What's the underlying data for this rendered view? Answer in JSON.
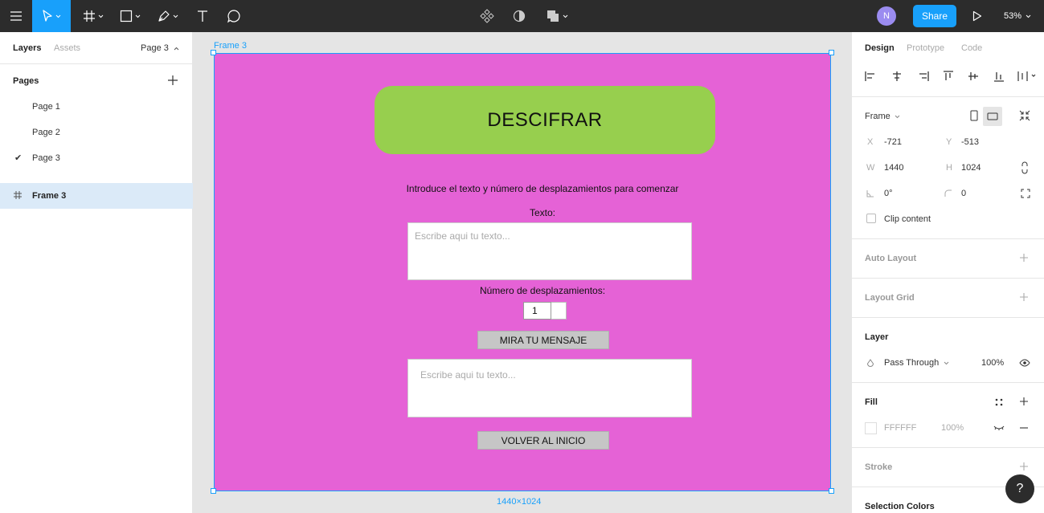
{
  "toolbar": {
    "share_label": "Share",
    "zoom": "53%",
    "avatar_initial": "N"
  },
  "left_panel": {
    "tabs": [
      "Layers",
      "Assets"
    ],
    "current_page": "Page 3",
    "pages_heading": "Pages",
    "pages": [
      "Page 1",
      "Page 2",
      "Page 3"
    ],
    "selected_page_check": "✔",
    "layer_name": "Frame 3"
  },
  "canvas": {
    "frame_label": "Frame 3",
    "size_label": "1440×1024",
    "frame_fill": "#e562d6",
    "title_button": "DESCIFRAR",
    "intro_text": "Introduce el texto y número de desplazamientos para comenzar",
    "texto_label": "Texto:",
    "texto_placeholder": "Escribe aqui tu texto...",
    "num_label": "Número de desplazamientos:",
    "num_value": "1",
    "message_button": "MIRA TU MENSAJE",
    "output_placeholder": "Escribe aqui tu texto...",
    "back_button": "VOLVER AL INICIO"
  },
  "right_panel": {
    "tabs": [
      "Design",
      "Prototype",
      "Code"
    ],
    "frame_type": "Frame",
    "x_label": "X",
    "x_value": "-721",
    "y_label": "Y",
    "y_value": "-513",
    "w_label": "W",
    "w_value": "1440",
    "h_label": "H",
    "h_value": "1024",
    "rotation_value": "0°",
    "radius_value": "0",
    "clip_content": "Clip content",
    "auto_layout": "Auto Layout",
    "layout_grid": "Layout Grid",
    "layer_heading": "Layer",
    "blend_mode": "Pass Through",
    "layer_opacity": "100%",
    "fill_heading": "Fill",
    "fill_hex": "FFFFFF",
    "fill_opacity": "100%",
    "stroke_heading": "Stroke",
    "selection_colors": "Selection Colors"
  },
  "help_label": "?"
}
